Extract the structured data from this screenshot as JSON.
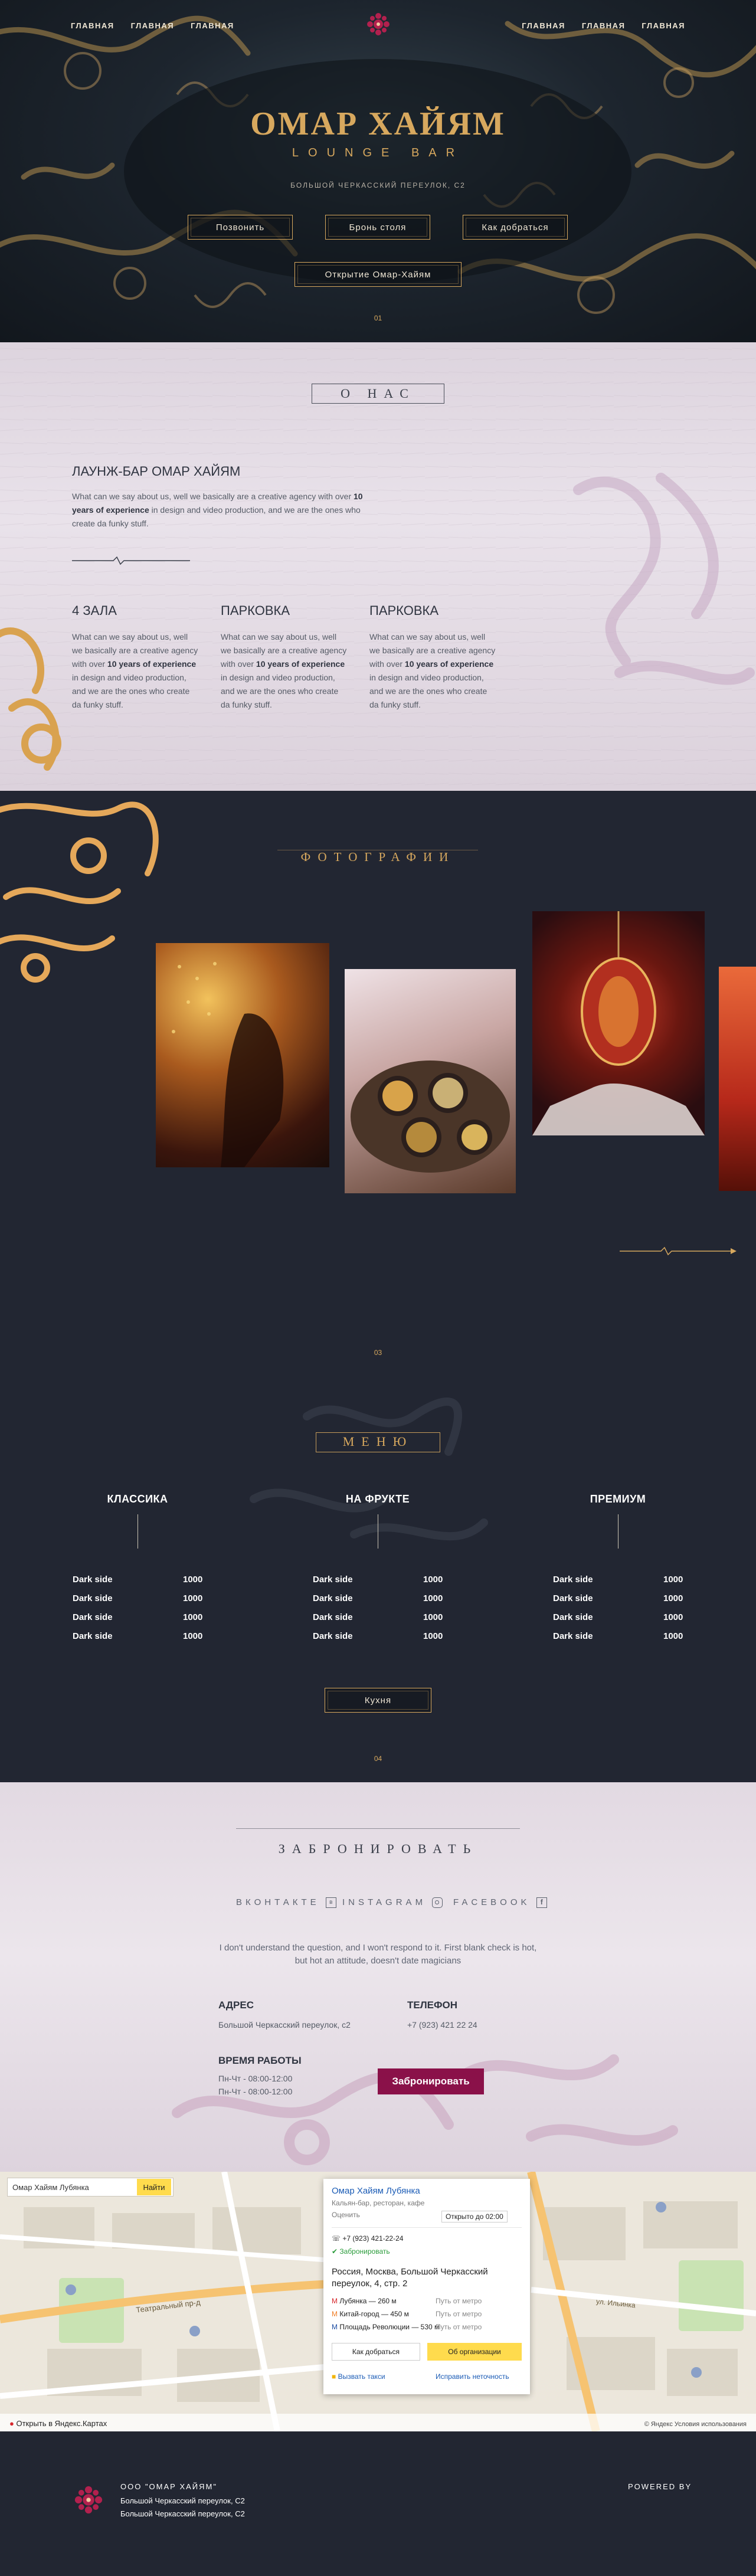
{
  "nav": {
    "left": [
      "ГЛАВНАЯ",
      "ГЛАВНАЯ",
      "ГЛАВНАЯ"
    ],
    "right": [
      "ГЛАВНАЯ",
      "ГЛАВНАЯ",
      "ГЛАВНАЯ"
    ]
  },
  "hero": {
    "title": "ОМАР ХАЙЯМ",
    "subtitle": "LOUNGE BAR",
    "address": "БОЛЬШОЙ ЧЕРКАССКИЙ ПЕРЕУЛОК, С2",
    "btn_call": "Позвонить",
    "btn_book": "Бронь столя",
    "btn_route": "Как добраться",
    "btn_opening": "Открытие Омар-Хайям",
    "section_number": "01"
  },
  "about": {
    "section_title": "О НАС",
    "heading": "ЛАУНЖ-БАР ОМАР ХАЙЯМ",
    "text_before": "What can we say about us, well we basically are a creative agency with over ",
    "text_bold": "10 years of experience",
    "text_after": " in design and video production, and we are the ones who create da funky stuff.",
    "columns": [
      {
        "title": "4 ЗАЛА",
        "text_before": "What can we say about us, well we basically are a creative agency with over ",
        "text_bold": "10 years of experience",
        "text_after": " in design and video production, and we are the ones who create da funky stuff."
      },
      {
        "title": "ПАРКОВКА",
        "text_before": "What can we say about us, well we basically are a creative agency with over ",
        "text_bold": "10 years of experience",
        "text_after": " in design and video production, and we are the ones who create da funky stuff."
      },
      {
        "title": "ПАРКОВКА",
        "text_before": "What can we say about us, well we basically are a creative agency with over ",
        "text_bold": "10 years of experience",
        "text_after": " in design and video production, and we are the ones who create da funky stuff."
      }
    ]
  },
  "photos": {
    "section_title": "ФОТОГРАФИИ",
    "section_number": "03"
  },
  "menu": {
    "section_title": "МЕНЮ",
    "categories": [
      "КЛАССИКА",
      "НА ФРУКТЕ",
      "ПРЕМИУМ"
    ],
    "item_name": "Dark side",
    "item_price": "1000",
    "kitchen_button": "Кухня",
    "section_number": "04"
  },
  "booking": {
    "section_title": "ЗАБРОНИРОВАТЬ",
    "vk": "ВКОНТАКТЕ",
    "instagram": "INSTAGRAM",
    "facebook": "FACEBOOK",
    "quote_line1": "I don't understand the question, and I won't respond to it. First blank check is hot,",
    "quote_line2": "but hot an attitude, doesn't date magicians",
    "address_label": "АДРЕС",
    "address_value": "Большой Черкасский переулок, с2",
    "phone_label": "ТЕЛЕФОН",
    "phone_value": "+7 (923) 421 22 24",
    "hours_label": "ВРЕМЯ РАБОТЫ",
    "hours_1": "Пн-Чт - 08:00-12:00",
    "hours_2": "Пн-Чт - 08:00-12:00",
    "book_button": "Забронировать"
  },
  "map": {
    "search_value": "Омар Хайям Лубянка",
    "find_button": "Найти",
    "card_title": "Омар Хайям Лубянка",
    "card_subtitle": "Кальян-бар, ресторан, кафе",
    "card_rate": "Оценить",
    "card_status": "Открыто до 02:00",
    "card_phone": "+7 (923) 421-22-24",
    "card_booking": "Забронировать",
    "card_address": "Россия, Москва, Большой Черкасский переулок, 4, стр. 2",
    "metro_1": "Лубянка — 260 м",
    "metro_2": "Китай-город — 450 м",
    "metro_3": "Площадь Революции — 530 м",
    "route": "Путь от метро",
    "btn_route": "Как добраться",
    "btn_about": "Об организации",
    "taxi": "Вызвать такси",
    "fix": "Исправить неточность",
    "street_1": "Театральный пр-д",
    "street_2": "ул. Ильинка",
    "open_in": "Открыть в Яндекс.Картах",
    "copyright": "© Яндекс Условия использования"
  },
  "footer": {
    "company": "ООО \"ОМАР ХАЙЯМ\"",
    "address_1": "Большой Черкасский переулок, С2",
    "address_2": "Большой Черкасский переулок, С2",
    "powered": "POWERED BY"
  },
  "colors": {
    "gold": "#d7a85e",
    "dark": "#222632",
    "lavender": "#e4dbe4",
    "wine": "#8a1149"
  }
}
